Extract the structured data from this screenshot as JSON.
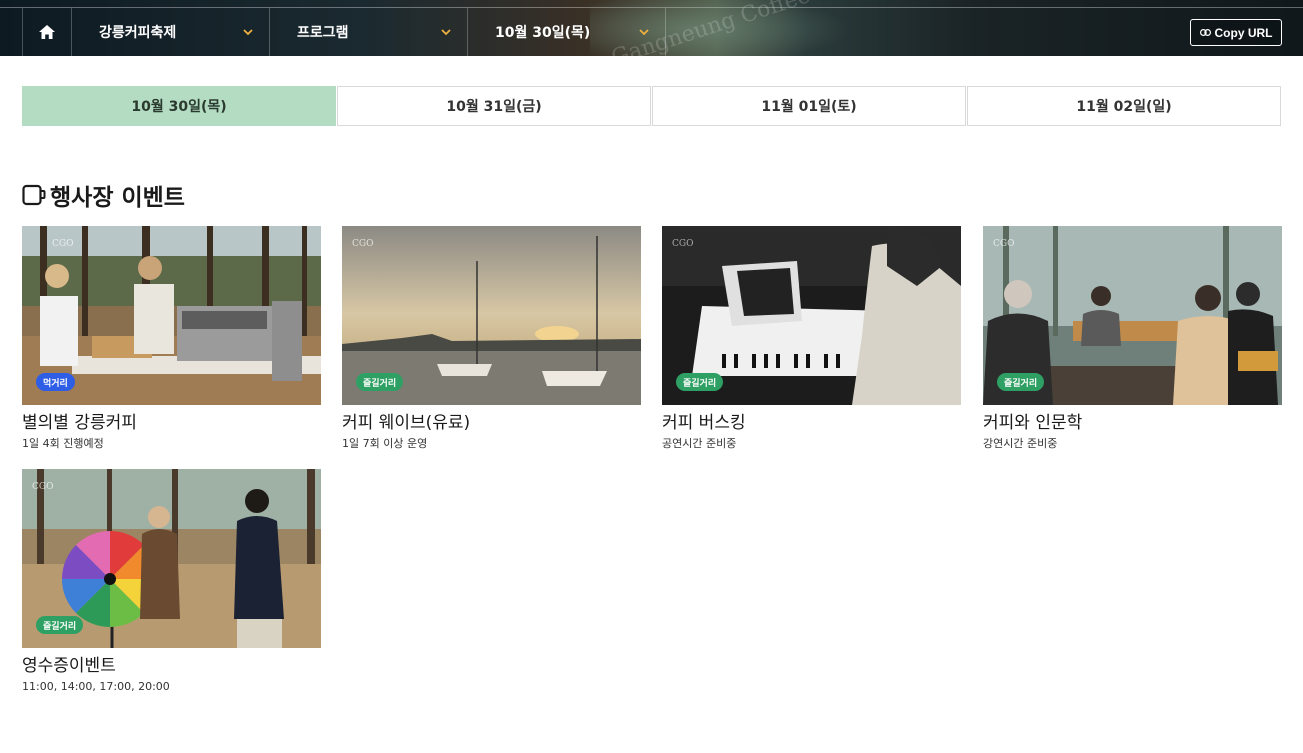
{
  "header": {
    "nav_items": [
      {
        "label": "강릉커피축제"
      },
      {
        "label": "프로그램"
      },
      {
        "label": "10월 30일(목)"
      }
    ],
    "copy_url_label": "Copy URL",
    "background_text": "Gangneung Coffee Festival"
  },
  "date_tabs": [
    {
      "label": "10월 30일(목)",
      "active": true
    },
    {
      "label": "10월 31일(금)",
      "active": false
    },
    {
      "label": "11월 01일(토)",
      "active": false
    },
    {
      "label": "11월 02일(일)",
      "active": false
    }
  ],
  "section": {
    "title": "행사장 이벤트",
    "icon": "coffee-cup-icon"
  },
  "events": [
    {
      "title": "별의별 강릉커피",
      "subtitle": "1일 4회 진행예정",
      "badge": "먹거리",
      "badge_color": "#2f5ee6"
    },
    {
      "title": "커피 웨이브(유료)",
      "subtitle": "1일 7회 이상 운영",
      "badge": "즐길거리",
      "badge_color": "#2fa063"
    },
    {
      "title": "커피 버스킹",
      "subtitle": "공연시간 준비중",
      "badge": "즐길거리",
      "badge_color": "#2fa063"
    },
    {
      "title": "커피와 인문학",
      "subtitle": "강연시간 준비중",
      "badge": "즐길거리",
      "badge_color": "#2fa063"
    },
    {
      "title": "영수증이벤트",
      "subtitle": "11:00, 14:00, 17:00, 20:00",
      "badge": "즐길거리",
      "badge_color": "#2fa063"
    }
  ],
  "colors": {
    "active_tab": "#b3dcc3",
    "badge_food": "#2f5ee6",
    "badge_fun": "#2fa063"
  }
}
